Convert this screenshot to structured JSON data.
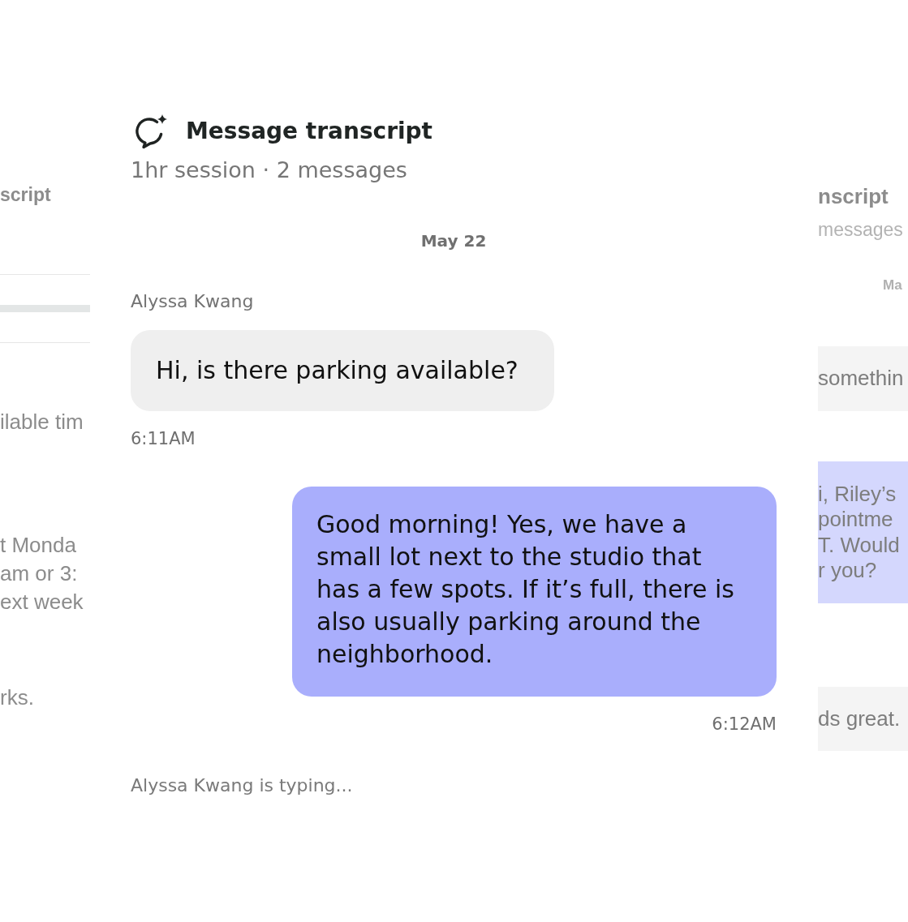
{
  "left_card": {
    "title": "script",
    "messages": [
      {
        "lines": [
          "ilable tim"
        ]
      },
      {
        "lines": [
          "t Monda",
          "am or 3:",
          "ext week"
        ]
      },
      {
        "lines": [
          "rks."
        ]
      }
    ]
  },
  "transcript": {
    "title": "Message transcript",
    "subtitle": "1hr session · 2 messages",
    "date": "May 22",
    "messages": [
      {
        "kind": "incoming",
        "name": "Alyssa Kwang",
        "text": "Hi, is there parking available?",
        "time": "6:11AM"
      },
      {
        "kind": "outgoing",
        "text": "Good morning! Yes, we have a small lot next to the studio that has a few spots. If it’s full, there is also usually parking around the neighborhood.",
        "time": "6:12AM"
      }
    ],
    "typing": "Alyssa Kwang is typing..."
  },
  "right_card": {
    "title": "nscript",
    "subtitle": "messages",
    "date": "Ma",
    "messages": [
      {
        "kind": "incoming",
        "lines": [
          "somethin"
        ]
      },
      {
        "kind": "outgoing",
        "lines": [
          "i, Riley’s",
          "pointme",
          "T. Would",
          "r you?"
        ]
      },
      {
        "kind": "incoming",
        "lines": [
          "ds great."
        ]
      }
    ]
  }
}
